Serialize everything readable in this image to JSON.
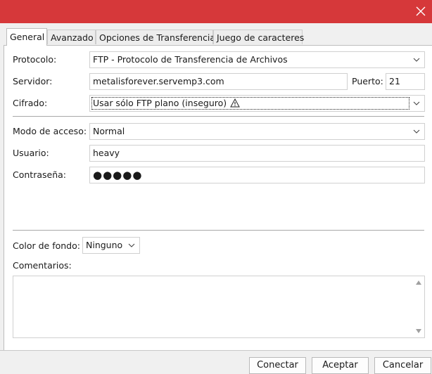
{
  "tabs": [
    "General",
    "Avanzado",
    "Opciones de Transferencia",
    "Juego de caracteres"
  ],
  "general": {
    "protocol_label": "Protocolo:",
    "protocol_value": "FTP - Protocolo de Transferencia de Archivos",
    "server_label": "Servidor:",
    "server_value": "metalisforever.servemp3.com",
    "port_label": "Puerto:",
    "port_value": "21",
    "encryption_label": "Cifrado:",
    "encryption_value": "Usar sólo FTP plano (inseguro)",
    "access_mode_label": "Modo de acceso:",
    "access_mode_value": "Normal",
    "user_label": "Usuario:",
    "user_value": "heavy",
    "password_label": "Contraseña:",
    "password_value": "●●●●●",
    "bg_color_label": "Color de fondo:",
    "bg_color_value": "Ninguno",
    "comments_label": "Comentarios:",
    "comments_value": ""
  },
  "buttons": {
    "connect": "Conectar",
    "accept": "Aceptar",
    "cancel": "Cancelar"
  },
  "icons": {
    "close": "close-icon",
    "chevron": "chevron-down-icon",
    "warning": "warning-icon"
  },
  "colors": {
    "titlebar": "#d6383a",
    "panel": "#ffffff",
    "window": "#f0f0f0"
  }
}
